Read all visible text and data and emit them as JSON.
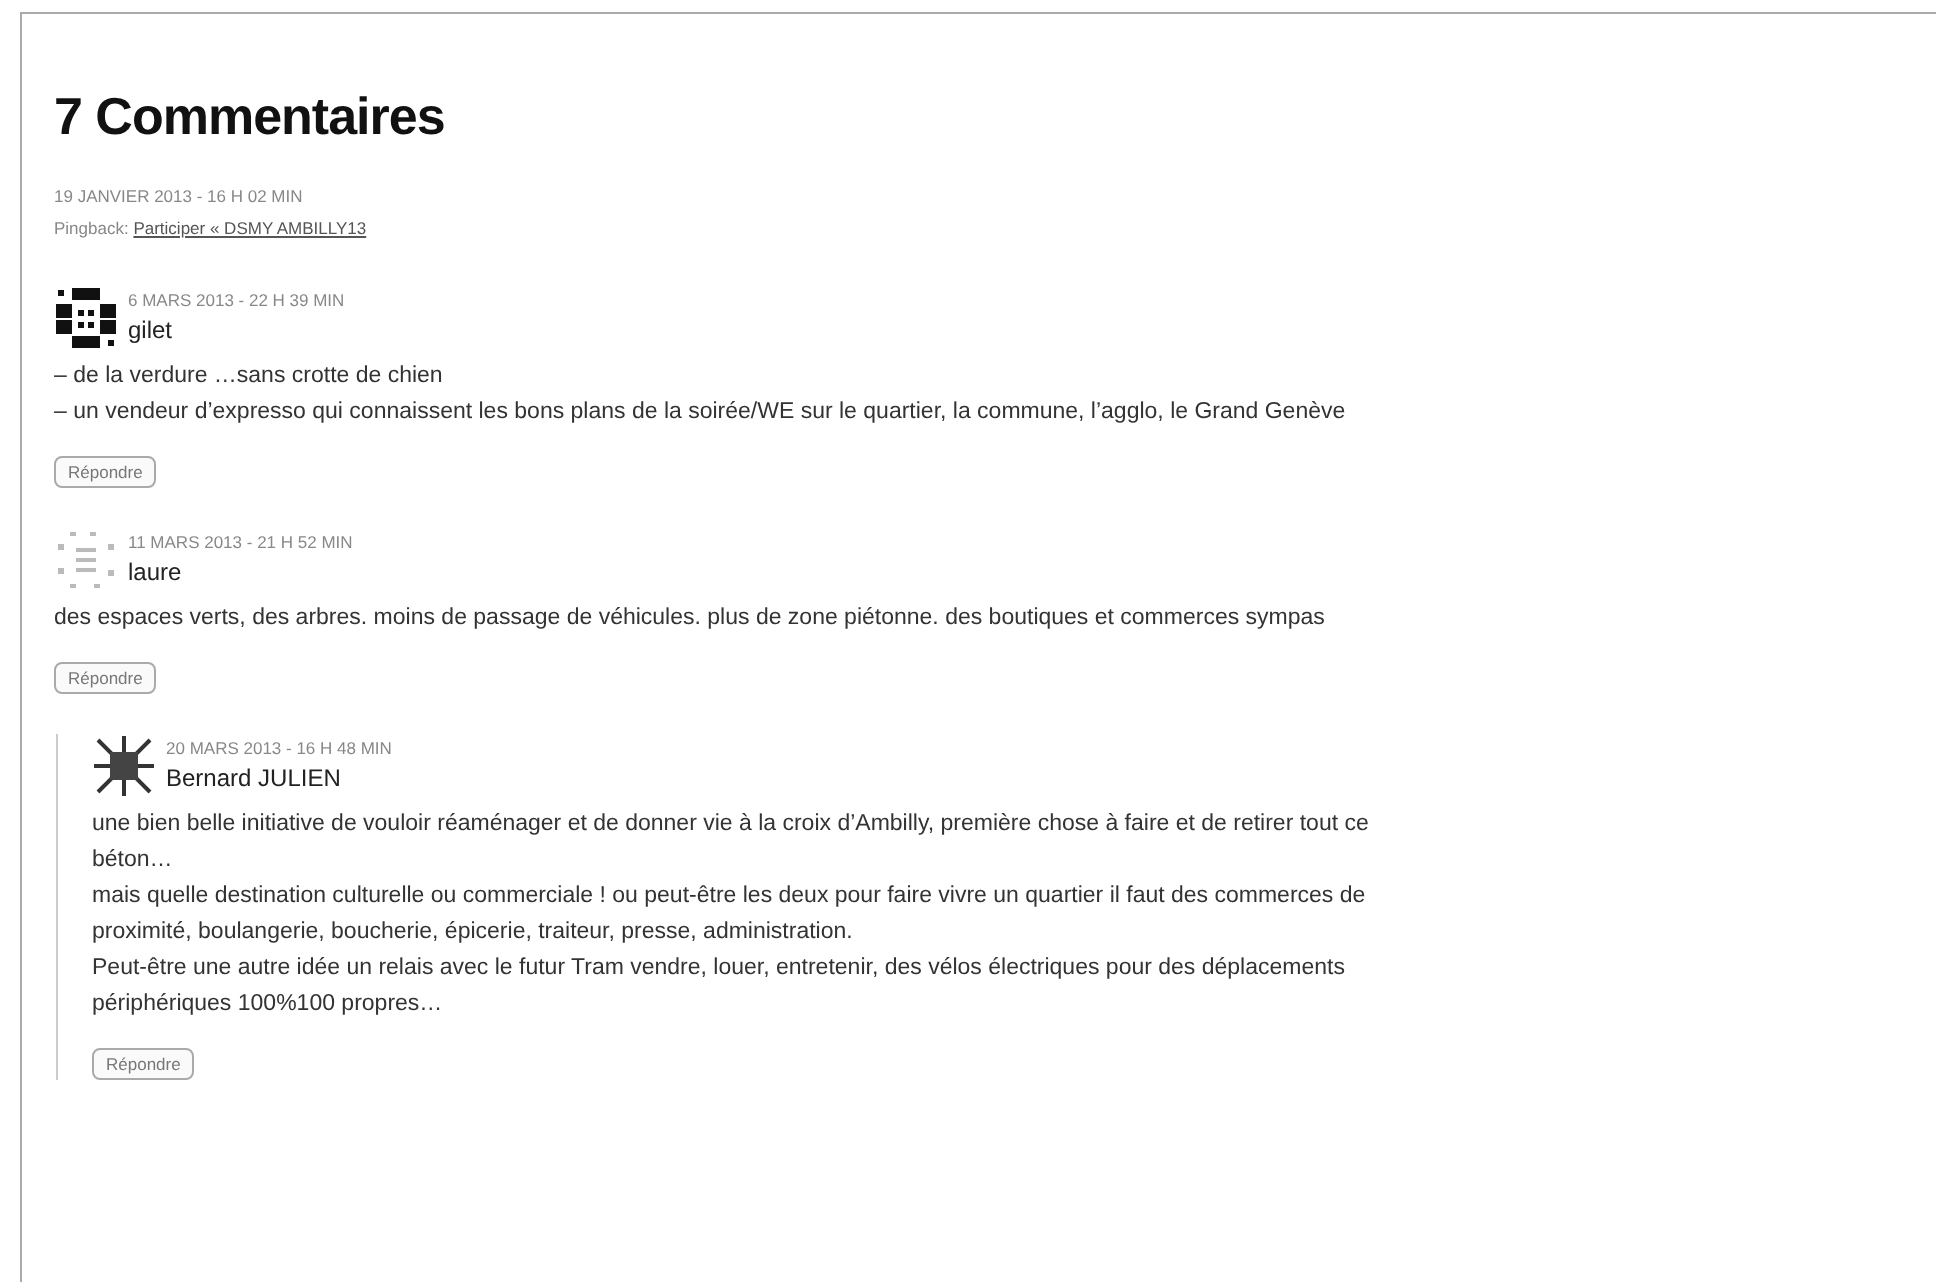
{
  "heading": "7 Commentaires",
  "comments": [
    {
      "kind": "pingback",
      "date": "19 JANVIER 2013 - 16 H 02 MIN",
      "label": "Pingback:",
      "link": "Participer « DSMY AMBILLY13"
    },
    {
      "kind": "comment",
      "avatar": {
        "kind": "blocks"
      },
      "date": "6 MARS 2013 - 22 H 39 MIN",
      "author": "gilet",
      "paragraphs": [
        "– de la verdure …sans crotte de chien",
        "– un vendeur d’expresso qui connaissent les bons plans de la soirée/WE sur le quartier, la commune, l’agglo, le Grand Genève"
      ],
      "reply": "Répondre",
      "nested": false
    },
    {
      "kind": "comment",
      "avatar": {
        "kind": "dots"
      },
      "date": "11 MARS 2013 - 21 H 52 MIN",
      "author": "laure",
      "paragraphs": [
        "des espaces verts, des arbres. moins de passage de véhicules. plus de zone piétonne. des boutiques et commerces sympas"
      ],
      "reply": "Répondre",
      "nested": false
    },
    {
      "kind": "comment",
      "avatar": {
        "kind": "burst"
      },
      "date": "20 MARS 2013 - 16 H 48 MIN",
      "author": "Bernard JULIEN",
      "paragraphs": [
        "une bien belle initiative de vouloir réaménager et de donner vie à la croix d’Ambilly, première chose à faire et de retirer tout ce béton…",
        "mais quelle destination culturelle ou commerciale ! ou peut-être les deux pour faire vivre un quartier il faut des commerces de proximité, boulangerie, boucherie, épicerie, traiteur, presse, administration.",
        "Peut-être une autre idée un relais avec le futur Tram vendre, louer, entretenir, des vélos électriques pour des déplacements périphériques 100%100 propres…"
      ],
      "reply": "Répondre",
      "nested": true
    }
  ]
}
